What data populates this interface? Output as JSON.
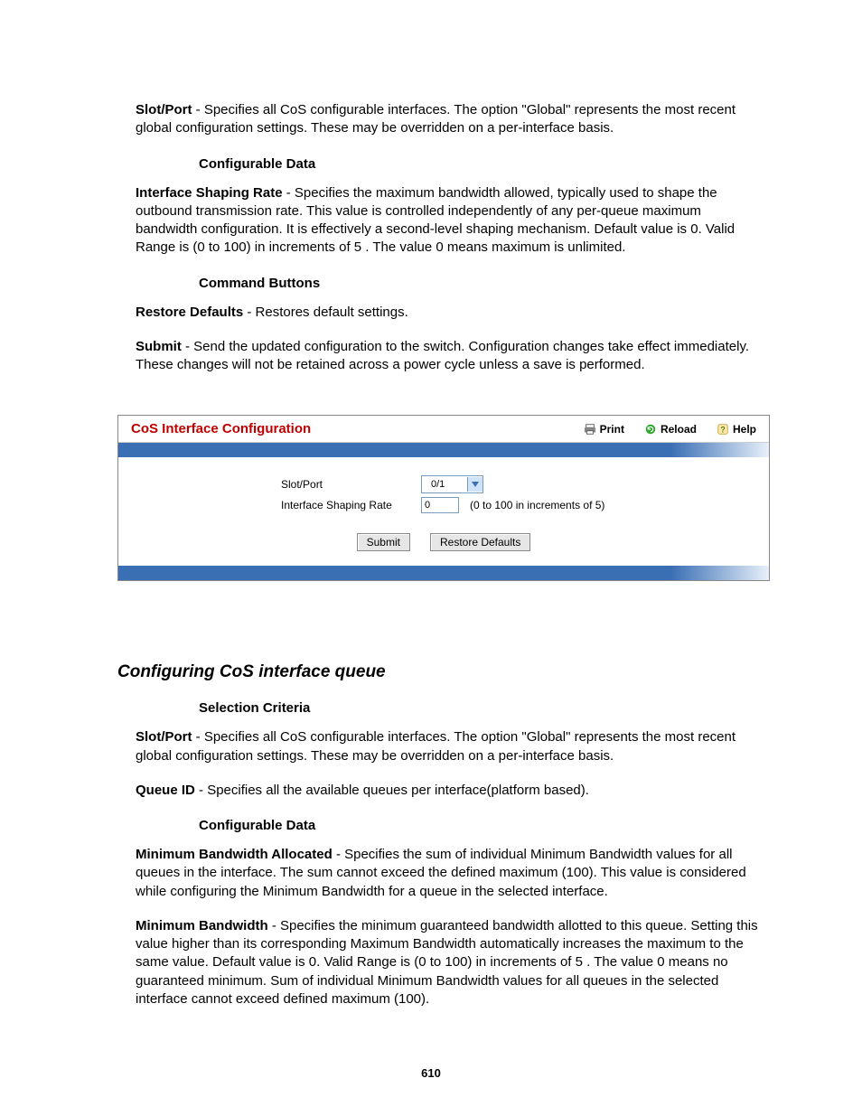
{
  "sec1": {
    "slot_port_label": "Slot/Port",
    "slot_port_text": " - Specifies all CoS configurable interfaces. The option \"Global\" represents the most recent global configuration settings. These may be overridden on a per-interface basis.",
    "configurable_data_heading": "Configurable Data",
    "shaping_label": "Interface Shaping Rate",
    "shaping_text": " - Specifies the maximum bandwidth allowed, typically used to shape the outbound transmission rate. This value is controlled independently of any per-queue maximum bandwidth configuration. It is effectively a second-level shaping mechanism. Default value is 0. Valid Range is (0 to 100) in increments of 5 . The value 0 means maximum is unlimited.",
    "command_buttons_heading": "Command Buttons",
    "restore_label": "Restore Defaults",
    "restore_text": " - Restores default settings.",
    "submit_label": "Submit",
    "submit_text": " - Send the updated configuration to the switch. Configuration changes take effect immediately. These changes will not be retained across a power cycle unless a save is performed."
  },
  "screenshot": {
    "title": "CoS Interface Configuration",
    "print": "Print",
    "reload": "Reload",
    "help": "Help",
    "row1_label": "Slot/Port",
    "row1_value": "0/1",
    "row2_label": "Interface Shaping Rate",
    "row2_value": "0",
    "row2_hint": "(0 to 100 in increments of 5)",
    "btn_submit": "Submit",
    "btn_restore": "Restore Defaults"
  },
  "sec2": {
    "title": "Configuring CoS interface queue",
    "selection_heading": "Selection Criteria",
    "slot_port_label": "Slot/Port",
    "slot_port_text": " - Specifies all CoS configurable interfaces. The option \"Global\" represents the most recent global configuration settings. These may be overridden on a per-interface basis.",
    "queue_label": "Queue ID",
    "queue_text": " - Specifies all the available queues per interface(platform based).",
    "configurable_data_heading": "Configurable Data",
    "min_bw_alloc_label": "Minimum Bandwidth Allocated",
    "min_bw_alloc_text": " - Specifies the sum of individual Minimum Bandwidth values for all queues in the interface. The sum cannot exceed the defined maximum (100). This value is considered while configuring the Minimum Bandwidth for a queue in the selected interface.",
    "min_bw_label": "Minimum Bandwidth",
    "min_bw_text": " - Specifies the minimum guaranteed bandwidth allotted to this queue. Setting this value higher than its corresponding Maximum Bandwidth automatically increases the maximum to the same value. Default value is 0. Valid Range is (0 to 100) in increments of 5 . The value 0 means no guaranteed minimum. Sum of individual Minimum Bandwidth values for all queues in the selected interface cannot exceed defined maximum (100)."
  },
  "page_number": "610"
}
